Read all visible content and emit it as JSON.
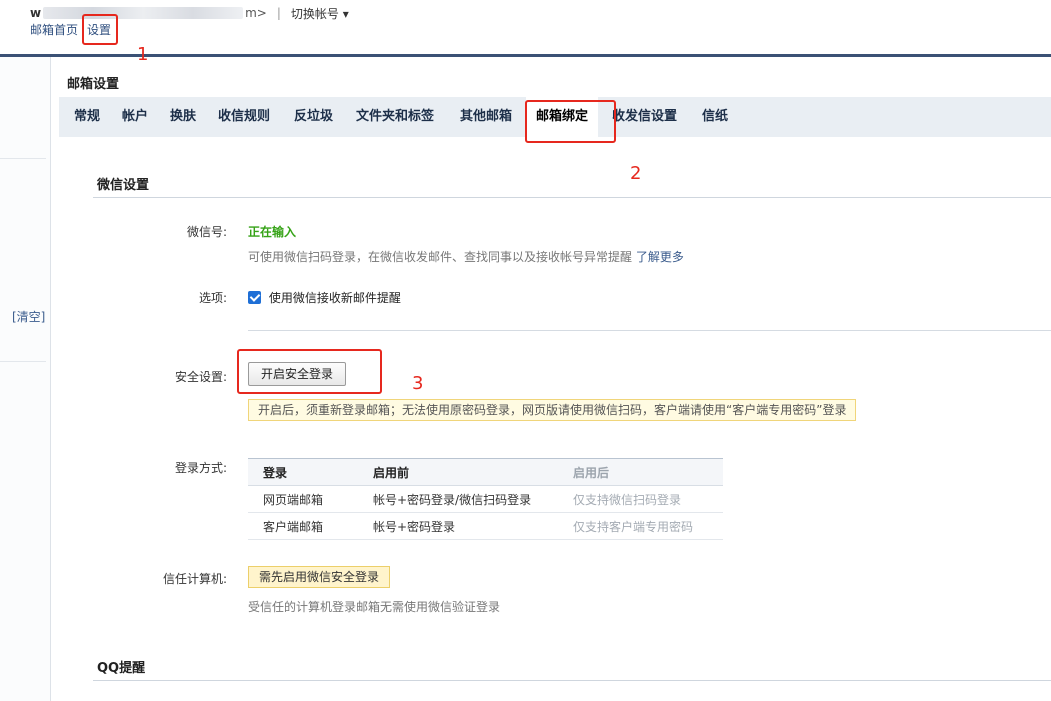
{
  "header": {
    "account_prefix": "w",
    "account_suffix": "m>",
    "separator": "|",
    "switch_account": "切换帐号",
    "switch_caret": "▾",
    "nav": {
      "home": "邮箱首页",
      "settings": "设置"
    }
  },
  "sidebar": {
    "clear_link": "[清空]"
  },
  "page_title": "邮箱设置",
  "tabs": [
    {
      "label": "常规"
    },
    {
      "label": "帐户"
    },
    {
      "label": "换肤"
    },
    {
      "label": "收信规则"
    },
    {
      "label": "反垃圾"
    },
    {
      "label": "文件夹和标签"
    },
    {
      "label": "其他邮箱"
    },
    {
      "label": "邮箱绑定",
      "active": true
    },
    {
      "label": "收发信设置"
    },
    {
      "label": "信纸"
    }
  ],
  "wechat": {
    "section_title": "微信设置",
    "id_label": "微信号:",
    "id_status": "正在输入",
    "description": "可使用微信扫码登录，在微信收发邮件、查找同事以及接收帐号异常提醒",
    "learn_more": "了解更多",
    "option_label": "选项:",
    "option_checkbox": "使用微信接收新邮件提醒",
    "option_checked": true,
    "security_label": "安全设置:",
    "security_button": "开启安全登录",
    "security_warning": "开启后，须重新登录邮箱；无法使用原密码登录，网页版请使用微信扫码，客户端请使用“客户端专用密码”登录",
    "login_label": "登录方式:",
    "login_table": {
      "headers": [
        "登录",
        "启用前",
        "启用后"
      ],
      "rows": [
        [
          "网页端邮箱",
          "帐号+密码登录/微信扫码登录",
          "仅支持微信扫码登录"
        ],
        [
          "客户端邮箱",
          "帐号+密码登录",
          "仅支持客户端专用密码"
        ]
      ]
    },
    "trusted_label": "信任计算机:",
    "trusted_tag": "需先启用微信安全登录",
    "trusted_hint": "受信任的计算机登录邮箱无需使用微信验证登录"
  },
  "qq": {
    "section_title": "QQ提醒"
  },
  "annotations": {
    "step1": "1",
    "step2": "2",
    "step3": "3"
  },
  "colors": {
    "accent_bar": "#3b5175",
    "annotation_red": "#e6281e",
    "status_green": "#36a317",
    "checkbox_blue": "#1f6fd6"
  }
}
